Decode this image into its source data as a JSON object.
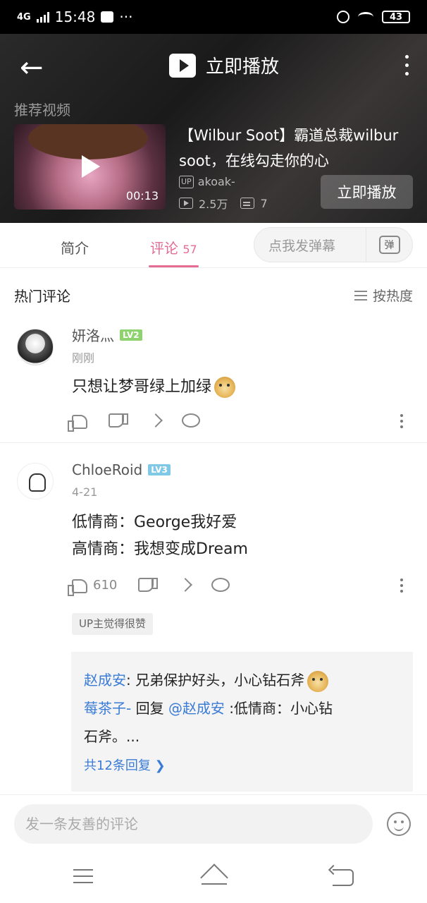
{
  "status": {
    "time": "15:48",
    "network": "4G",
    "battery": "43"
  },
  "header": {
    "title": "立即播放"
  },
  "recommend": {
    "label": "推荐视频",
    "video": {
      "title": "【Wilbur Soot】霸道总裁wilbur soot，在线勾走你的心",
      "duration": "00:13",
      "uploader_badge": "UP",
      "uploader": "akoak-",
      "views": "2.5万",
      "danmaku": "7",
      "play_label": "立即播放"
    }
  },
  "tabs": {
    "intro": "简介",
    "comments": "评论",
    "comments_count": "57",
    "danmaku_placeholder": "点我发弹幕",
    "danmaku_icon": "弹"
  },
  "comments_header": {
    "title": "热门评论",
    "sort": "按热度"
  },
  "comments": [
    {
      "user": "妍洛灬",
      "level": "LV2",
      "time": "刚刚",
      "text": "只想让梦哥绿上加绿",
      "likes": ""
    },
    {
      "user": "ChloeRoid",
      "level": "LV3",
      "time": "4-21",
      "text_line1": "低情商：George我好爱",
      "text_line2": "高情商：我想变成Dream",
      "likes": "610",
      "up_tag": "UP主觉得很赞",
      "replies": [
        {
          "name": "赵成安",
          "text": ": 兄弟保护好头，小心钻石斧"
        },
        {
          "name": "莓茶子-",
          "mid": " 回复 ",
          "at": "@赵成安",
          "text": " :低情商：小心钻",
          "text_cont": "石斧。..."
        }
      ],
      "more_replies": "共12条回复 ❯"
    }
  ],
  "input": {
    "placeholder": "发一条友善的评论"
  }
}
